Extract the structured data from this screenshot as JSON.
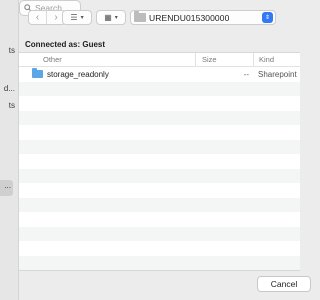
{
  "sidebar": {
    "fragments": [
      "ts",
      "d...",
      "ts"
    ],
    "selected_fragment": "..."
  },
  "toolbar": {
    "back_icon": "chevron-left-icon",
    "forward_icon": "chevron-right-icon",
    "location": "URENDU015300000",
    "search_placeholder": "Search"
  },
  "connection": {
    "label": "Connected as: Guest"
  },
  "file_list": {
    "columns": {
      "name": "Other",
      "size": "Size",
      "kind": "Kind"
    },
    "items": [
      {
        "name": "storage_readonly",
        "size": "--",
        "kind": "Sharepoint"
      }
    ]
  },
  "footer": {
    "cancel_label": "Cancel"
  }
}
